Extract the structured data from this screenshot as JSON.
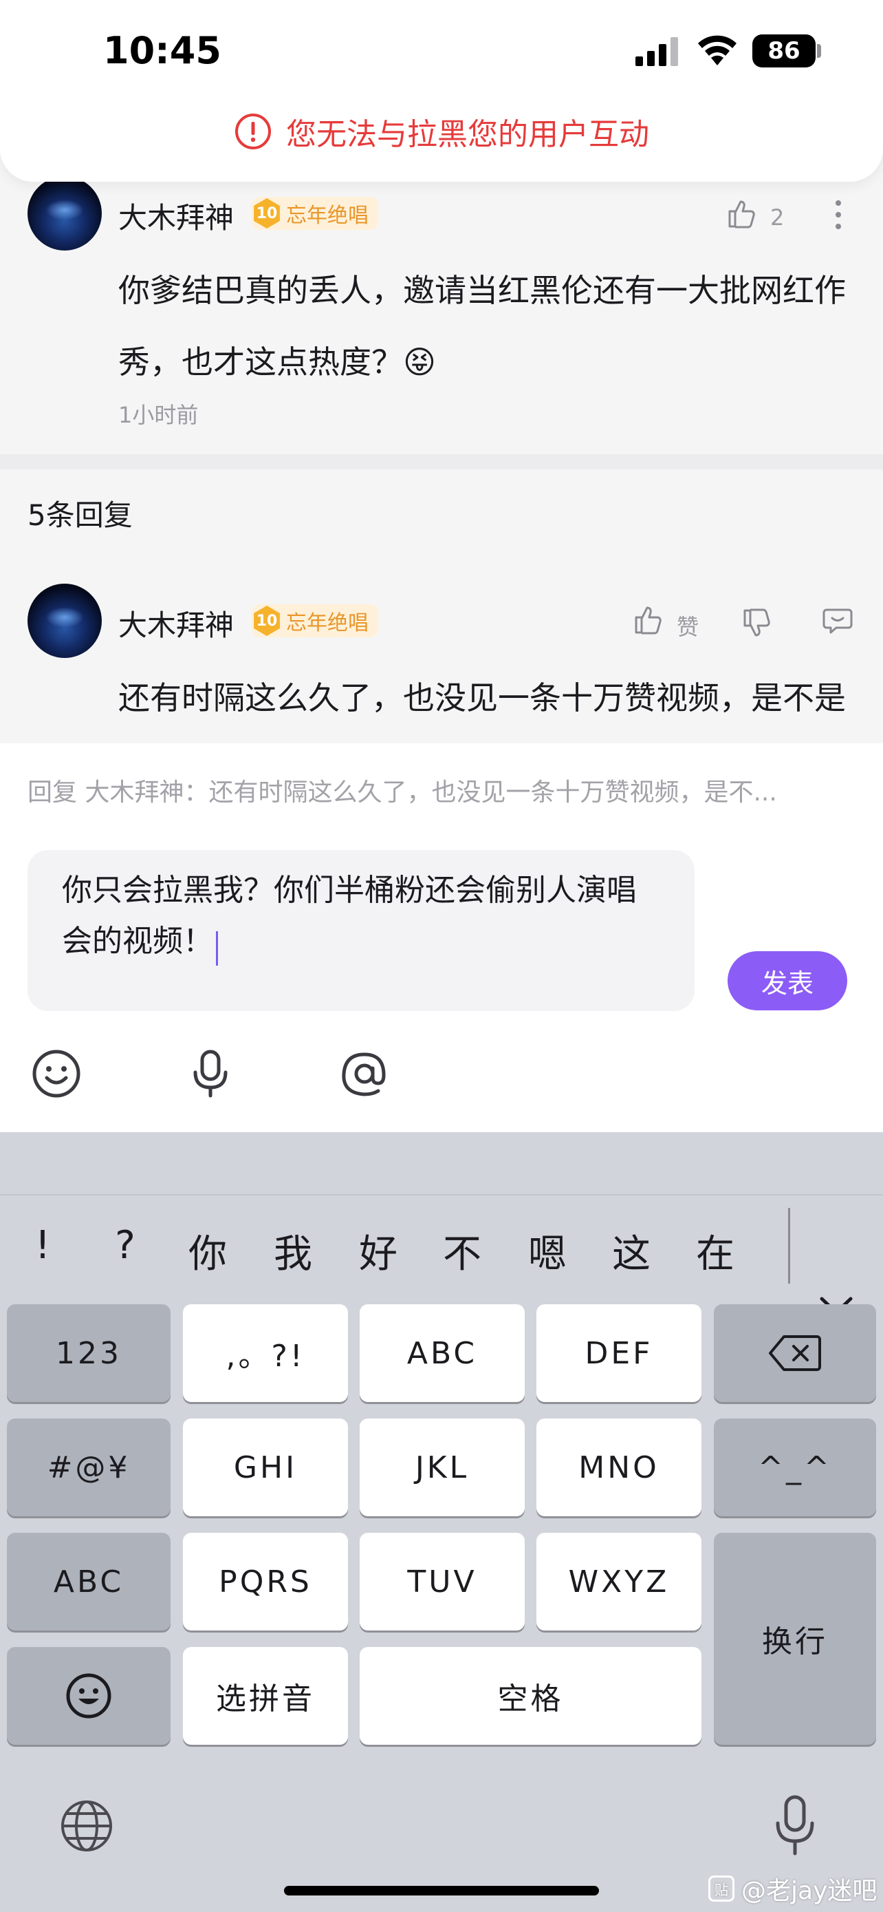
{
  "status_bar": {
    "time": "10:45",
    "battery": "86"
  },
  "warning": {
    "text": "您无法与拉黑您的用户互动"
  },
  "parent_comment": {
    "username": "大木拜神",
    "badge_level": "10",
    "badge_title": "忘年绝唱",
    "like_count": "2",
    "text": "你爹结巴真的丢人，邀请当红黑伦还有一大批网红作秀，也才这点热度？😝",
    "time": "1小时前"
  },
  "replies_header": "5条回复",
  "reply_comment": {
    "username": "大木拜神",
    "badge_level": "10",
    "badge_title": "忘年绝唱",
    "like_label": "赞",
    "text": "还有时隔这么久了，也没见一条十万赞视频，是不是黄光大本营解散了？请不够人了？😝"
  },
  "composer": {
    "reply_preview": "回复 大木拜神：还有时隔这么久了，也没见一条十万赞视频，是不...",
    "input_text": "你只会拉黑我？你们半桶粉还会偷别人演唱会的视频！",
    "send_label": "发表"
  },
  "keyboard": {
    "candidates": [
      "!",
      "?",
      "你",
      "我",
      "好",
      "不",
      "嗯",
      "这",
      "在"
    ],
    "keys": {
      "num": "123",
      "punct": ",。?!",
      "abc": "ABC",
      "def": "DEF",
      "symbols": "#@¥",
      "ghi": "GHI",
      "jkl": "JKL",
      "mno": "MNO",
      "kaomoji": "^_^",
      "abc_switch": "ABC",
      "pqrs": "PQRS",
      "tuv": "TUV",
      "wxyz": "WXYZ",
      "return": "换行",
      "pinyin": "选拼音",
      "space": "空格"
    }
  },
  "watermark": "@老jay迷吧",
  "colors": {
    "accent": "#8c5cf6",
    "warning": "#e63b3b",
    "badge": "#f6b22b"
  }
}
